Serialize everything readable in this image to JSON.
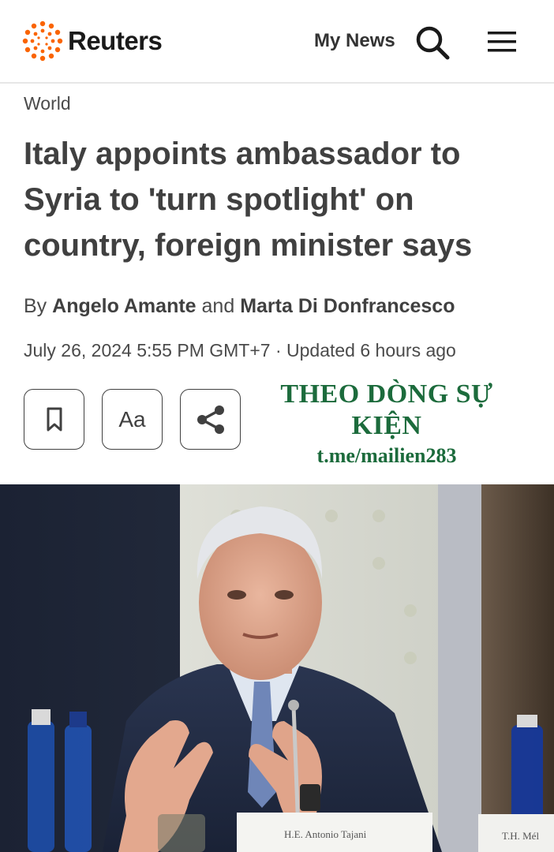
{
  "header": {
    "logo_text": "Reuters",
    "my_news_label": "My News",
    "search_icon": "search-icon",
    "menu_icon": "hamburger-menu-icon"
  },
  "article": {
    "section": "World",
    "title": "Italy appoints ambassador to Syria to 'turn spotlight' on country, foreign minister says",
    "by_prefix": "By",
    "author1": "Angelo Amante",
    "and_word": "and",
    "author2": "Marta Di Donfrancesco",
    "dateline": "July 26, 2024 5:55 PM GMT+7 · Updated 6 hours ago"
  },
  "tools": {
    "bookmark_icon": "bookmark-icon",
    "text_size_label": "Aa",
    "share_icon": "share-icon"
  },
  "watermark": {
    "line1": "THEO DÒNG SỰ KIỆN",
    "line2": "t.me/mailien283"
  },
  "photo": {
    "nameplate_left": "H.E. Antonio Tajani",
    "nameplate_right": "T.H. Mél"
  },
  "colors": {
    "logo_orange": "#fa6400",
    "text": "#404040",
    "watermark_green": "#1c6b3c"
  }
}
